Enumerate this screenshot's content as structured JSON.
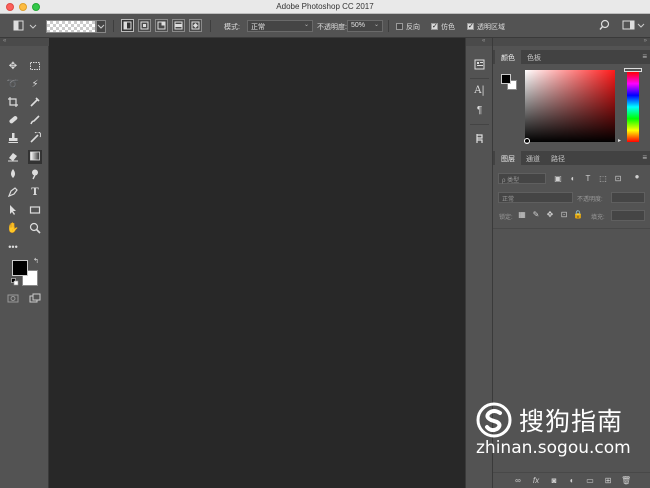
{
  "window": {
    "title": "Adobe Photoshop CC 2017"
  },
  "options_bar": {
    "mode_label": "模式:",
    "mode_value": "正常",
    "opacity_label": "不透明度:",
    "opacity_value": "50%",
    "reverse_label": "反向",
    "dither_label": "仿色",
    "transparency_label": "透明区域",
    "reverse_checked": false,
    "dither_checked": true,
    "transparency_checked": true
  },
  "color_panel": {
    "tabs": [
      "颜色",
      "色板"
    ],
    "active_tab": "颜色"
  },
  "layers_panel": {
    "tabs": [
      "图层",
      "通道",
      "路径"
    ],
    "active_tab": "图层",
    "filter_placeholder": "ρ 类型",
    "blend_mode": "正常",
    "opacity_label": "不透明度:",
    "lock_label": "锁定:",
    "fill_label": "填充:"
  },
  "watermark": {
    "brand": "搜狗指南",
    "url": "zhinan.sogou.com"
  },
  "colors": {
    "foreground": "#000000",
    "background": "#ffffff",
    "ui_panel": "#535353",
    "canvas": "#282828"
  },
  "tools": [
    "move-tool",
    "marquee-tool",
    "lasso-tool",
    "magic-wand-tool",
    "crop-tool",
    "eyedropper-tool",
    "healing-brush-tool",
    "brush-tool",
    "clone-stamp-tool",
    "history-brush-tool",
    "eraser-tool",
    "gradient-tool",
    "blur-tool",
    "dodge-tool",
    "pen-tool",
    "type-tool",
    "path-selection-tool",
    "rectangle-tool",
    "hand-tool",
    "zoom-tool",
    "more-tools"
  ]
}
